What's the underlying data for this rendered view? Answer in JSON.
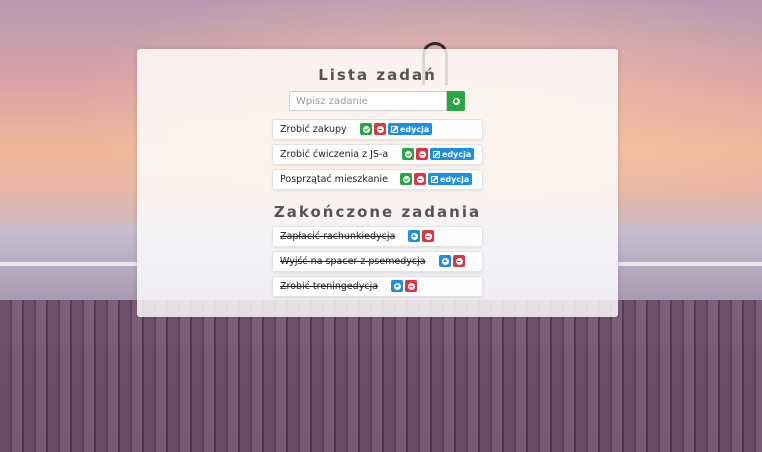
{
  "app": {
    "title": "Lista zadań",
    "done_title": "Zakończone zadania"
  },
  "input": {
    "placeholder": "Wpisz zadanie",
    "value": ""
  },
  "tasks": [
    {
      "text": "Zrobić zakupy",
      "edit_label": "edycja"
    },
    {
      "text": "Zrobić ćwiczenia z JS-a",
      "edit_label": "edycja"
    },
    {
      "text": "Posprzątać mieszkanie",
      "edit_label": "edycja"
    }
  ],
  "done_tasks": [
    {
      "text": "Zapłacić rachunkiedycja"
    },
    {
      "text": "Wyjść na spacer z psemedycja"
    },
    {
      "text": "Zrobić treningedycja"
    }
  ],
  "colors": {
    "green": "#28a745",
    "red": "#dc3545",
    "blue": "#1e8fe0"
  },
  "icons": [
    "plus-circle-icon",
    "check-circle-icon",
    "minus-circle-icon",
    "edit-icon",
    "arrow-up-circle-icon"
  ]
}
